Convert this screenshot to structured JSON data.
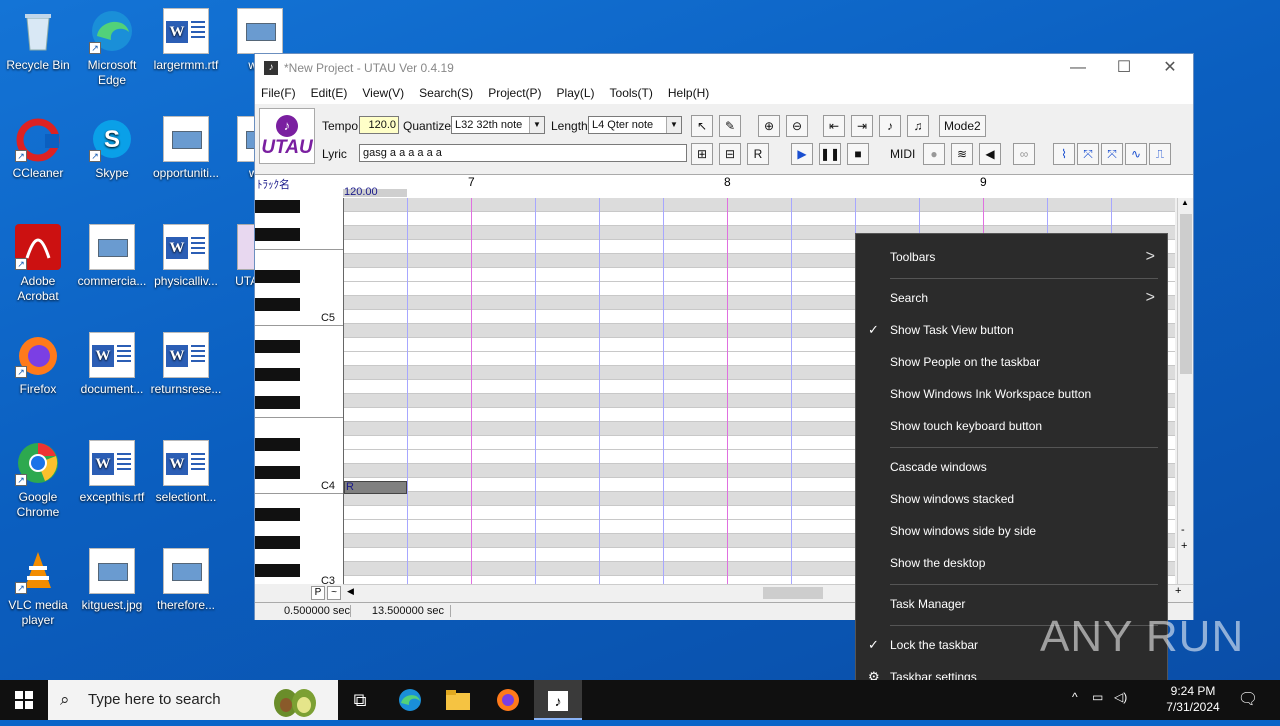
{
  "desktop": {
    "icons": [
      {
        "label": "Recycle Bin"
      },
      {
        "label": "Microsoft Edge"
      },
      {
        "label": "largermm.rtf"
      },
      {
        "label": "warr"
      },
      {
        "label": "CCleaner"
      },
      {
        "label": "Skype"
      },
      {
        "label": "opportuniti..."
      },
      {
        "label": "wee"
      },
      {
        "label": "Adobe Acrobat"
      },
      {
        "label": "commercia..."
      },
      {
        "label": "physicalliv..."
      },
      {
        "label": "UTA 合成"
      },
      {
        "label": "Firefox"
      },
      {
        "label": "document..."
      },
      {
        "label": "returnsrese..."
      },
      {
        "label": "Google Chrome"
      },
      {
        "label": "excepthis.rtf"
      },
      {
        "label": "selectiont..."
      },
      {
        "label": "VLC media player"
      },
      {
        "label": "kitguest.jpg"
      },
      {
        "label": "therefore..."
      }
    ]
  },
  "window": {
    "title": "*New Project - UTAU Ver 0.4.19",
    "menu": [
      "File(F)",
      "Edit(E)",
      "View(V)",
      "Search(S)",
      "Project(P)",
      "Play(L)",
      "Tools(T)",
      "Help(H)"
    ],
    "logo_text": "UTAU",
    "tempo_label": "Tempo",
    "tempo_value": "120.0",
    "quantize_label": "Quantize",
    "quantize_value": "L32 32th note",
    "length_label": "Length",
    "length_value": "L4  Qter note",
    "lyric_label": "Lyric",
    "lyric_value": "gasg  a a a                    a a a",
    "mode_button": "Mode2",
    "midi_label": "MIDI",
    "ruler_left_label": "ﾄﾗｯｸ名",
    "ruler_tempo": "120.00",
    "measures": [
      "7",
      "8",
      "9"
    ],
    "key_labels": [
      "C5",
      "C4",
      "C3"
    ],
    "note_text": "R",
    "status_time1": "0.500000 sec",
    "status_time2": "13.500000 sec",
    "hscroll_labels": [
      "P",
      "~"
    ]
  },
  "context_menu": {
    "items": [
      {
        "label": "Toolbars",
        "submenu": true
      },
      {
        "label": "Search",
        "submenu": true
      },
      {
        "label": "Show Task View button",
        "checked": true
      },
      {
        "label": "Show People on the taskbar"
      },
      {
        "label": "Show Windows Ink Workspace button"
      },
      {
        "label": "Show touch keyboard button"
      },
      {
        "label": "Cascade windows"
      },
      {
        "label": "Show windows stacked"
      },
      {
        "label": "Show windows side by side"
      },
      {
        "label": "Show the desktop"
      },
      {
        "label": "Task Manager"
      },
      {
        "label": "Lock the taskbar",
        "checked": true
      },
      {
        "label": "Taskbar settings"
      }
    ]
  },
  "taskbar": {
    "search_placeholder": "Type here to search",
    "time": "9:24 PM",
    "date": "7/31/2024"
  },
  "watermark": "ANY RUN"
}
